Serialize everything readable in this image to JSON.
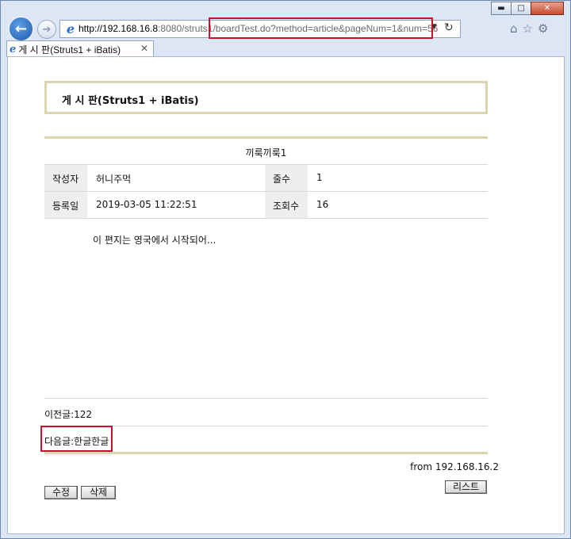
{
  "browser": {
    "address": {
      "host": "http://192.168.16.8",
      "rest": ":8080/struts1/boardTest.do?method=article&pageNum=1&num=56"
    },
    "tab": {
      "title": "게 시 판(Struts1 + iBatis)"
    },
    "icons": {
      "back": "back-arrow-icon",
      "forward": "forward-arrow-icon",
      "home": "home-icon",
      "favorites": "star-icon",
      "tools": "gear-icon"
    }
  },
  "board": {
    "header": "게 시 판(Struts1 + iBatis)",
    "subject": "끼룩끼룩1",
    "info": {
      "writer_label": "작성자",
      "writer": "허니주먹",
      "line_label": "줄수",
      "line_count": "1",
      "date_label": "등록일",
      "date": "2019-03-05 11:22:51",
      "views_label": "조회수",
      "views": "16"
    },
    "content": "이 편지는 영국에서 시작되어...",
    "prev": "이전글:122",
    "next": "다음글:한글한글",
    "from": "from 192.168.16.2",
    "buttons": {
      "edit": "수정",
      "delete": "삭제",
      "list": "리스트"
    }
  },
  "colors": {
    "accent_rule": "#dcd6b0",
    "highlight": "#c8102e",
    "ie_blue": "#2a6bd1"
  }
}
